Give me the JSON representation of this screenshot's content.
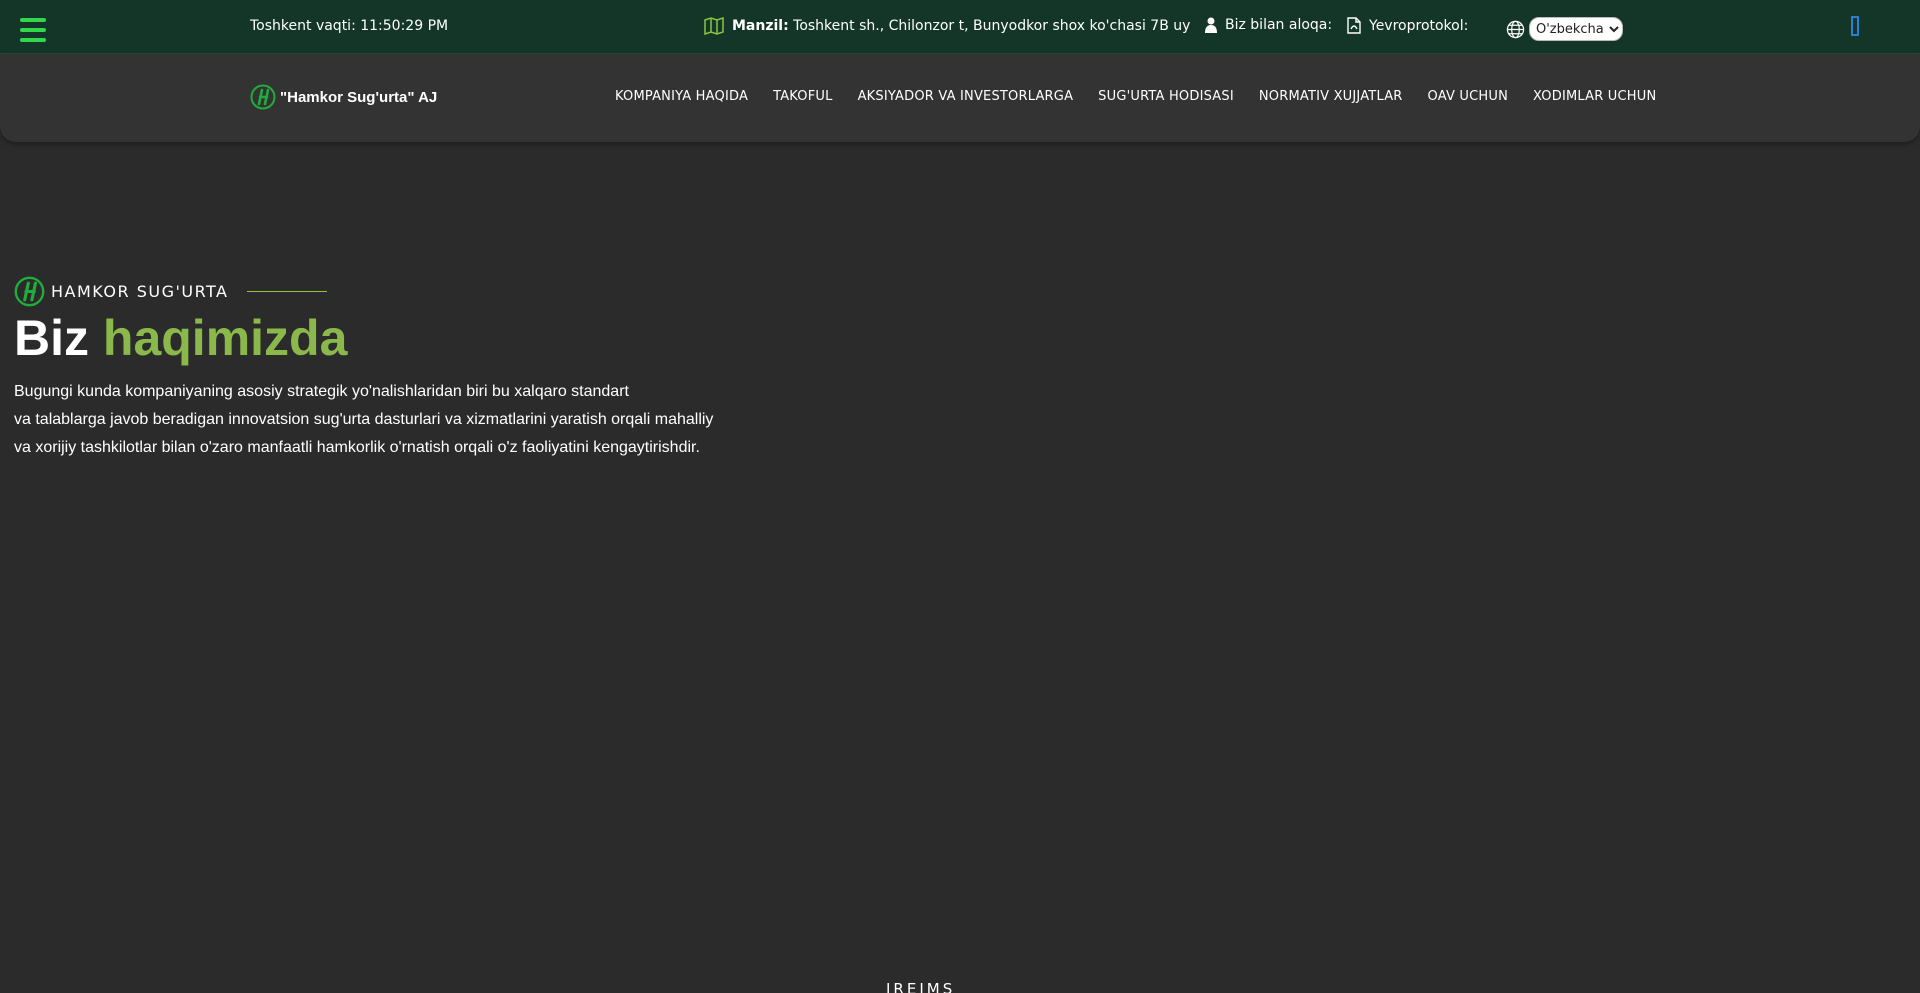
{
  "topbar": {
    "time": "Toshkent vaqti: 11:50:29 PM",
    "address_label": "Manzil:",
    "address_text": " Toshkent sh., Chilonzor t, Bunyodkor shox ko'chasi 7B uy",
    "contact_label": "Biz bilan aloqa:",
    "protocol_label": "Yevroprotokol:",
    "language_selected": "O'zbekcha",
    "icons": [
      "menu-icon",
      "map-icon",
      "user-icon",
      "pdf-icon",
      "globe-icon",
      "edge-icon"
    ],
    "colors": {
      "background": "#143628",
      "menu": "#32d74b",
      "map_icon": "#8cc63f"
    }
  },
  "nav": {
    "brand": "\"Hamkor Sug'urta\" AJ",
    "links": [
      "KOMPANIYA HAQIDA",
      "TAKOFUL",
      "AKSIYADOR VA INVESTORLARGA",
      "SUG'URTA HODISASI",
      "NORMATIV XUJJATLAR",
      "OAV UCHUN",
      "XODIMLAR UCHUN"
    ]
  },
  "hero": {
    "eyebrow": "HAMKOR SUG'URTA",
    "title_plain": "Biz ",
    "title_accent": "haqimizda",
    "paragraph": [
      "Bugungi kunda kompaniyaning asosiy strategik yo'nalishlaridan biri bu xalqaro standart",
      "va talablarga javob beradigan innovatsion sug'urta dasturlari va xizmatlarini yaratish orqali mahalliy",
      "va xorijiy tashkilotlar bilan o'zaro manfaatli hamkorlik o'rnatish orqali o'z faoliyatini kengaytirishdir."
    ],
    "accent_color": "#8bb84a"
  },
  "footer_peek": "IREJMS"
}
